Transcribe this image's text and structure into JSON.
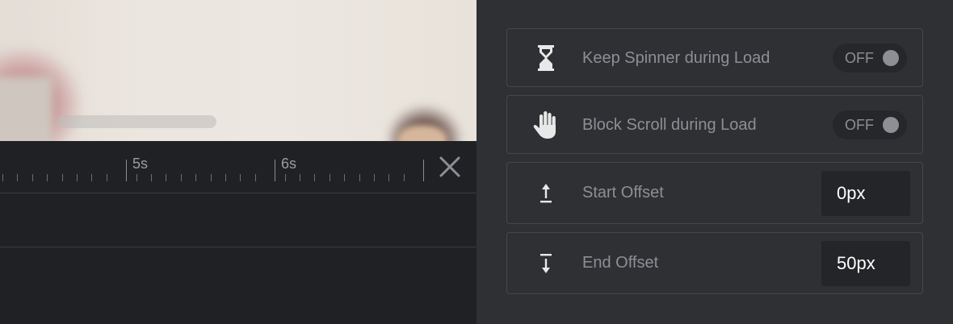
{
  "timeline": {
    "ticks": [
      {
        "label": "5s"
      },
      {
        "label": "6s"
      }
    ]
  },
  "settings": {
    "keep_spinner": {
      "label": "Keep Spinner during Load",
      "state": "OFF",
      "icon": "hourglass-icon"
    },
    "block_scroll": {
      "label": "Block Scroll during Load",
      "state": "OFF",
      "icon": "hand-icon"
    },
    "start_offset": {
      "label": "Start Offset",
      "value": "0px",
      "icon": "arrow-up-bar-icon"
    },
    "end_offset": {
      "label": "End Offset",
      "value": "50px",
      "icon": "arrow-down-bar-icon"
    }
  },
  "colors": {
    "panel_bg": "#2f3034",
    "editor_bg": "#202124",
    "text_muted": "#8d8f94",
    "value_text": "#ffffff"
  }
}
